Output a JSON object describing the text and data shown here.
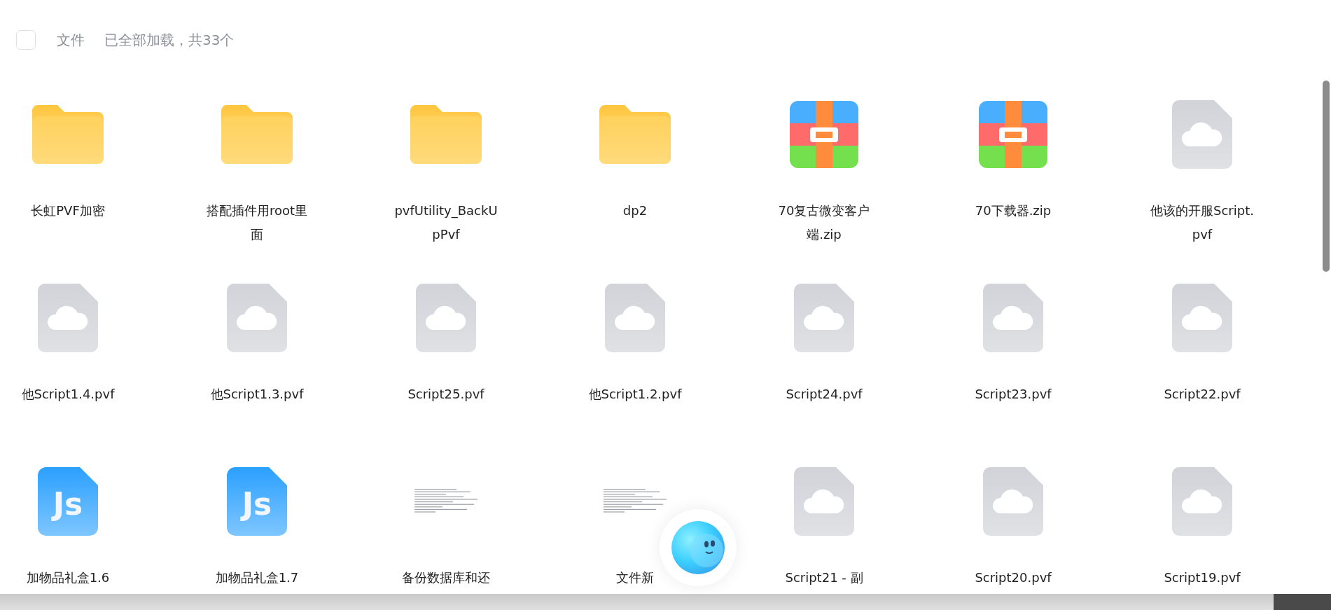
{
  "header": {
    "select_all": {
      "checked": false
    },
    "title": "文件",
    "status": "已全部加载，共33个"
  },
  "files": [
    {
      "kind": "folder",
      "name": "长虹PVF加密"
    },
    {
      "kind": "folder",
      "name": "搭配插件用root里面"
    },
    {
      "kind": "folder",
      "name": "pvfUtility_BackUpPvf"
    },
    {
      "kind": "folder",
      "name": "dp2"
    },
    {
      "kind": "zip",
      "name": "70复古微变客户端.zip"
    },
    {
      "kind": "zip",
      "name": "70下载器.zip"
    },
    {
      "kind": "cloud",
      "name": "他该的开服Script.pvf"
    },
    {
      "kind": "cloud",
      "name": "他Script1.4.pvf"
    },
    {
      "kind": "cloud",
      "name": "他Script1.3.pvf"
    },
    {
      "kind": "cloud",
      "name": "Script25.pvf"
    },
    {
      "kind": "cloud",
      "name": "他Script1.2.pvf"
    },
    {
      "kind": "cloud",
      "name": "Script24.pvf"
    },
    {
      "kind": "cloud",
      "name": "Script23.pvf"
    },
    {
      "kind": "cloud",
      "name": "Script22.pvf"
    },
    {
      "kind": "js",
      "name": "加物品礼盒1.6",
      "badge": "Js"
    },
    {
      "kind": "js",
      "name": "加物品礼盒1.7",
      "badge": "Js"
    },
    {
      "kind": "doc",
      "name": "备份数据库和还"
    },
    {
      "kind": "doc",
      "name": "文件新"
    },
    {
      "kind": "cloud",
      "name": "Script21 - 副"
    },
    {
      "kind": "cloud",
      "name": "Script20.pvf"
    },
    {
      "kind": "cloud",
      "name": "Script19.pvf"
    }
  ]
}
